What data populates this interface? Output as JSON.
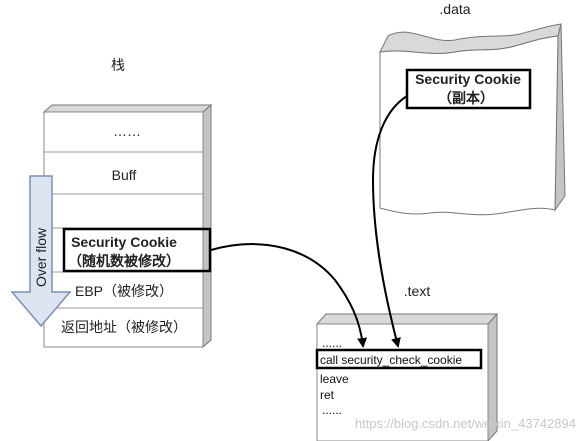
{
  "stack": {
    "title": "栈",
    "cells": {
      "dots": "……",
      "buff": "Buff",
      "cookie_line1": "Security Cookie",
      "cookie_line2": "（随机数被修改）",
      "ebp": "EBP（被修改）",
      "ret_addr": "返回地址（被修改）"
    },
    "overflow_label": "Over flow"
  },
  "data_section": {
    "title": ".data",
    "cookie_copy_line1": "Security Cookie",
    "cookie_copy_line2": "（副本）"
  },
  "text_section": {
    "title": ".text",
    "lines": {
      "dots_top": "......",
      "call": "call security_check_cookie",
      "leave": "leave",
      "ret": "ret",
      "dots_bottom": "......"
    }
  },
  "watermark": "https://blog.csdn.net/weixin_43742894",
  "colors": {
    "arrow_fill": "#dce4f2",
    "arrow_stroke": "#7d8fb3",
    "box_side": "#c4c4c4",
    "box_top": "#d9d9d9"
  }
}
